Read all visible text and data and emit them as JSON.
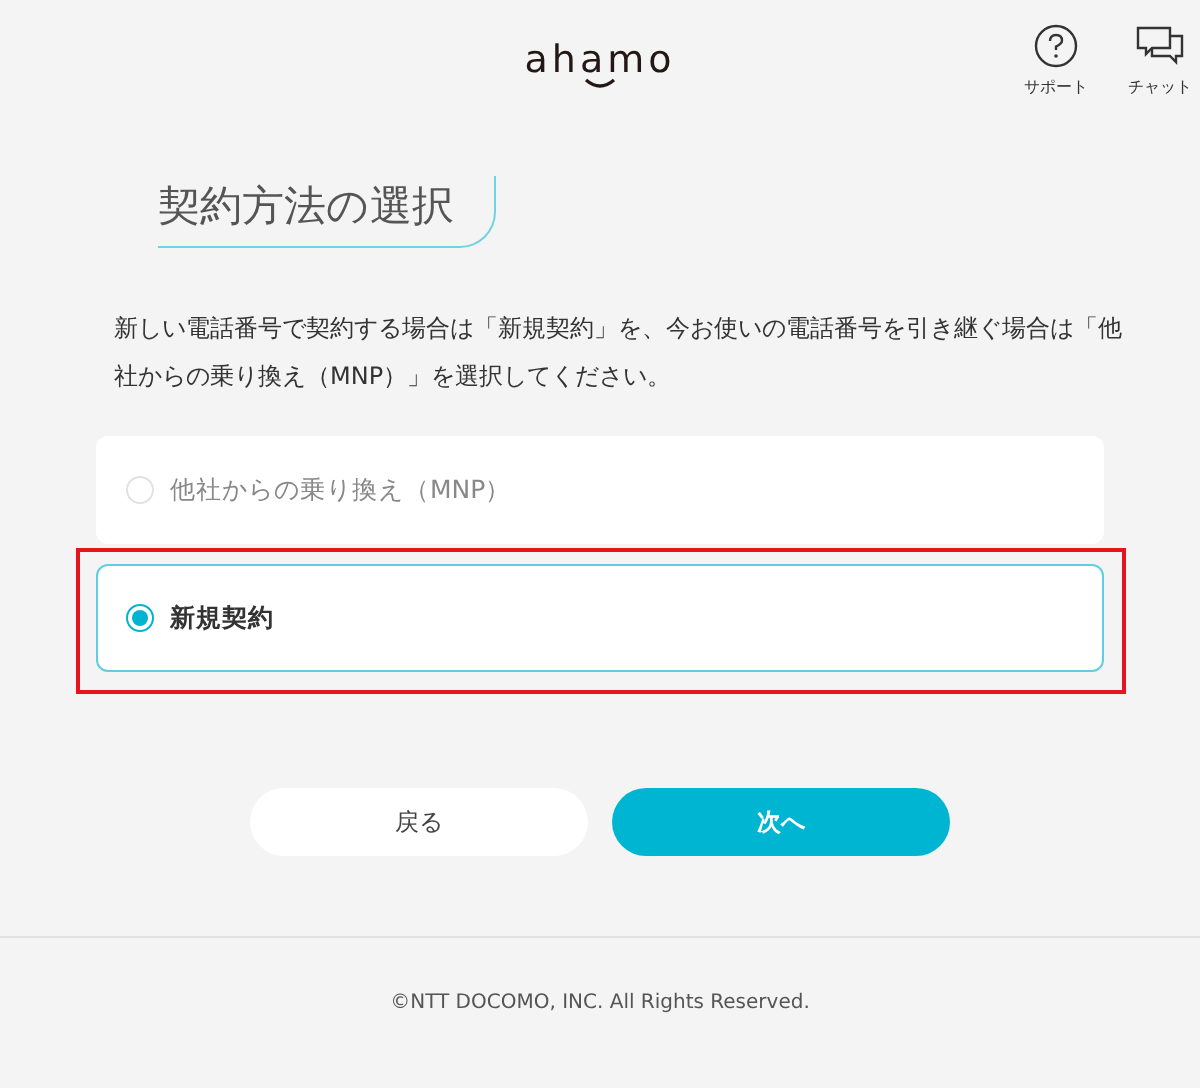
{
  "header": {
    "logo": "ahamo",
    "actions": [
      {
        "kind": "support",
        "label": "サポート"
      },
      {
        "kind": "chat",
        "label": "チャット"
      }
    ]
  },
  "title": "契約方法の選択",
  "description": "新しい電話番号で契約する場合は「新規契約」を、今お使いの電話番号を引き継ぐ場合は「他社からの乗り換え（MNP）」を選択してください。",
  "options": [
    {
      "label": "他社からの乗り換え（MNP）",
      "selected": false,
      "highlighted": false
    },
    {
      "label": "新規契約",
      "selected": true,
      "highlighted": true
    }
  ],
  "buttons": [
    {
      "kind": "secondary",
      "label": "戻る"
    },
    {
      "kind": "primary",
      "label": "次へ"
    }
  ],
  "footer": "©NTT DOCOMO, INC. All Rights Reserved."
}
